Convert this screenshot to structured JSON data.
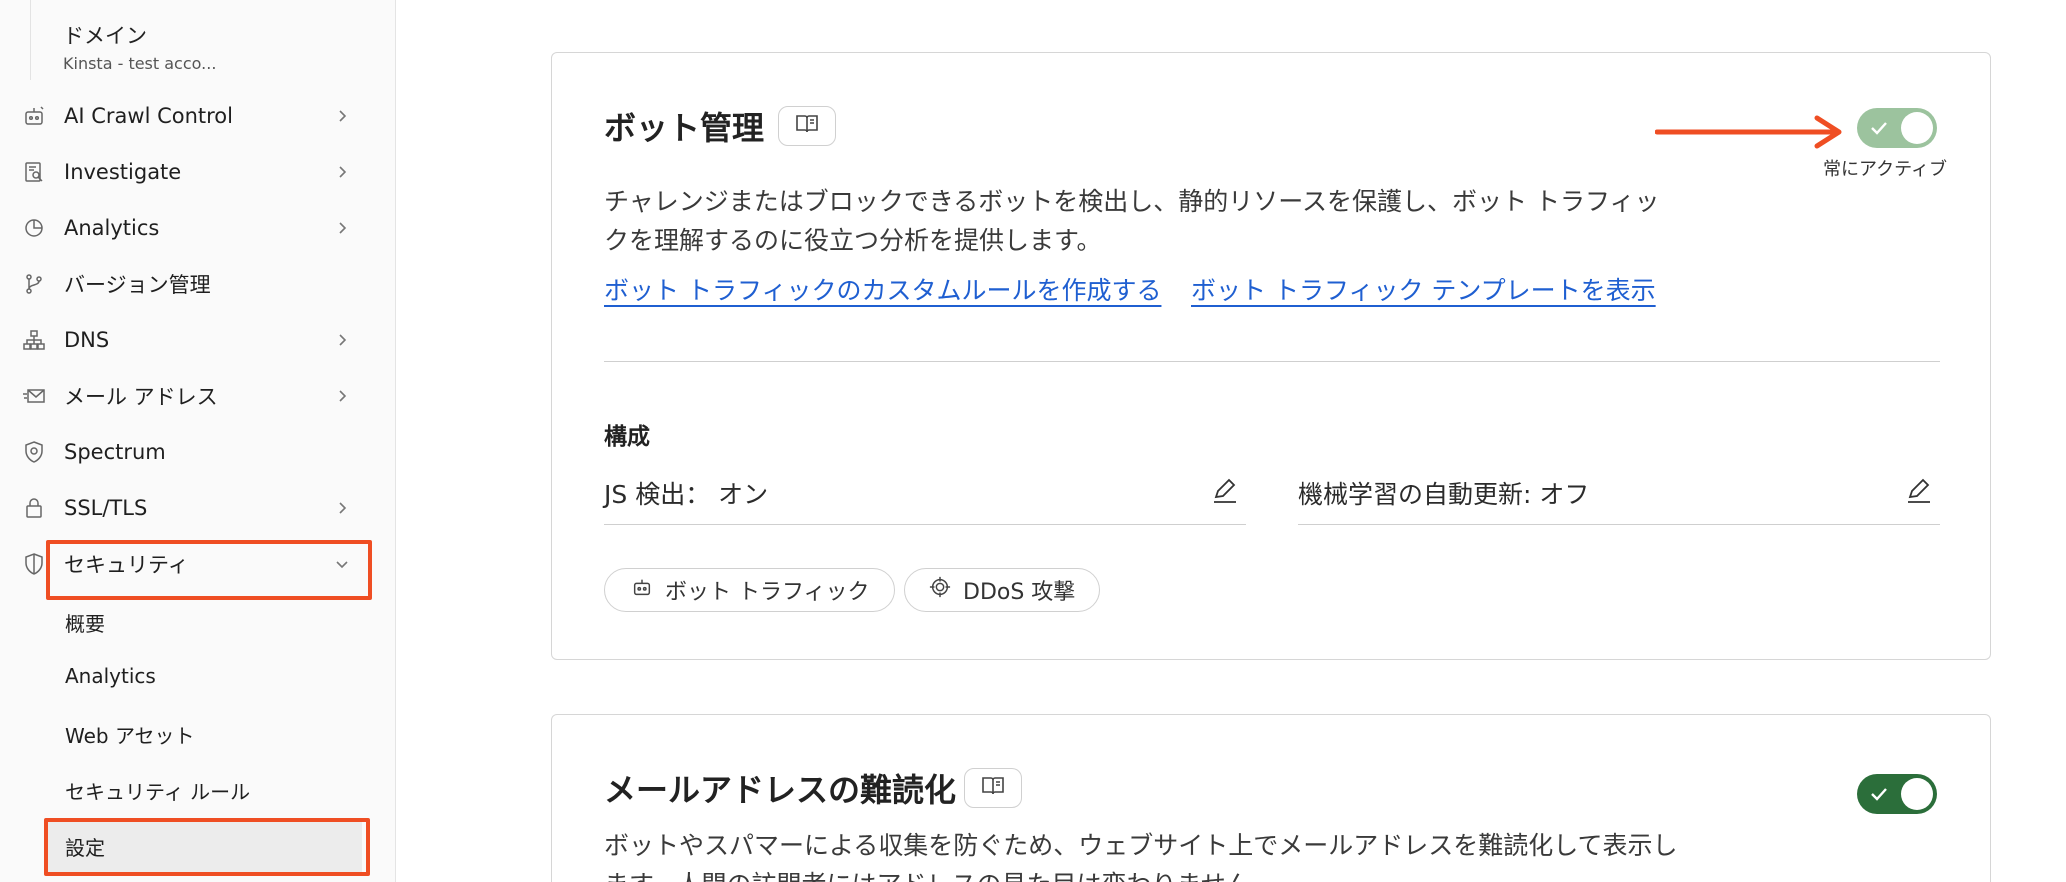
{
  "sidebar": {
    "domain": {
      "title": "ドメイン",
      "subtitle": "Kinsta - test acco..."
    },
    "items": [
      {
        "label": "AI Crawl Control",
        "icon": "robot-icon",
        "chevron": "chevron-right"
      },
      {
        "label": "Investigate",
        "icon": "investigate-icon",
        "chevron": "chevron-right"
      },
      {
        "label": "Analytics",
        "icon": "chart-pie-icon",
        "chevron": "chevron-right"
      },
      {
        "label": "バージョン管理",
        "icon": "branch-icon",
        "chevron": ""
      },
      {
        "label": "DNS",
        "icon": "network-icon",
        "chevron": "chevron-right"
      },
      {
        "label": "メール アドレス",
        "icon": "email-icon",
        "chevron": "chevron-right"
      },
      {
        "label": "Spectrum",
        "icon": "shield-gear-icon",
        "chevron": ""
      },
      {
        "label": "SSL/TLS",
        "icon": "lock-icon",
        "chevron": "chevron-right"
      },
      {
        "label": "セキュリティ",
        "icon": "shield-icon",
        "chevron": "chevron-down"
      }
    ],
    "security_subitems": [
      "概要",
      "Analytics",
      "Web アセット",
      "セキュリティ ルール",
      "設定"
    ]
  },
  "bot_management": {
    "title": "ボット管理",
    "toggle_caption": "常にアクティブ",
    "toggle_state": "on-disabled",
    "description": "チャレンジまたはブロックできるボットを検出し、静的リソースを保護し、ボット トラフィックを理解するのに役立つ分析を提供します。",
    "links": [
      "ボット トラフィックのカスタムルールを作成する",
      "ボット トラフィック テンプレートを表示"
    ],
    "config_title": "構成",
    "js_detection": "JS 検出： オン",
    "ml_auto_update": "機械学習の自動更新: オフ",
    "chips": [
      "ボット トラフィック",
      "DDoS 攻撃"
    ]
  },
  "email_obfuscation": {
    "title": "メールアドレスの難読化",
    "toggle_state": "on",
    "description": "ボットやスパマーによる収集を防ぐため、ウェブサイト上でメールアドレスを難読化して表示します。人間の訪問者にはアドレスの見た目は変わりません。"
  },
  "colors": {
    "highlight": "#ef4e23",
    "link": "#1f5fd1",
    "toggle_disabled": "#9cc39e",
    "toggle_on": "#2b6e3a"
  }
}
